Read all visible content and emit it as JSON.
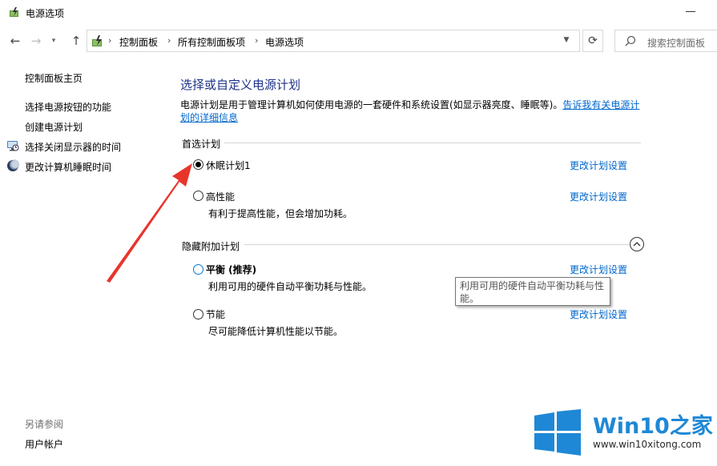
{
  "window": {
    "title": "电源选项"
  },
  "address_bar": {
    "breadcrumbs": [
      "控制面板",
      "所有控制面板项",
      "电源选项"
    ],
    "separator": "›"
  },
  "search": {
    "placeholder": "搜索控制面板"
  },
  "sidebar": {
    "home": "控制面板主页",
    "items": [
      {
        "label": "选择电源按钮的功能",
        "icon": ""
      },
      {
        "label": "创建电源计划",
        "icon": ""
      },
      {
        "label": "选择关闭显示器的时间",
        "icon": "clock-monitor-icon"
      },
      {
        "label": "更改计算机睡眠时间",
        "icon": "moon-icon"
      }
    ],
    "see_also": "另请参阅",
    "see_also_items": [
      "用户帐户"
    ]
  },
  "main": {
    "title": "选择或自定义电源计划",
    "description": "电源计划是用于管理计算机如何使用电源的一套硬件和系统设置(如显示器亮度、睡眠等)。",
    "description_link": "告诉我有关电源计划的详细信息",
    "preferred_group": "首选计划",
    "hidden_group": "隐藏附加计划",
    "change_settings_label": "更改计划设置",
    "plans": [
      {
        "name": "休眠计划1",
        "description": "",
        "selected": true
      },
      {
        "name": "高性能",
        "description": "有利于提高性能，但会增加功耗。",
        "selected": false
      },
      {
        "name": "平衡 (推荐)",
        "description": "利用可用的硬件自动平衡功耗与性能。",
        "selected": false
      },
      {
        "name": "节能",
        "description": "尽可能降低计算机性能以节能。",
        "selected": false
      }
    ]
  },
  "tooltip": {
    "text": "利用可用的硬件自动平衡功耗与性能。"
  },
  "annotation": {
    "arrow_color": "#e8352c"
  },
  "watermark": {
    "brand": "Win10",
    "brand_suffix": "之家",
    "url": "www.win10xitong.com",
    "colors": {
      "blue": "#1e88d6"
    }
  },
  "colors": {
    "title_blue": "#1e3287",
    "link_blue": "#0066cc"
  }
}
